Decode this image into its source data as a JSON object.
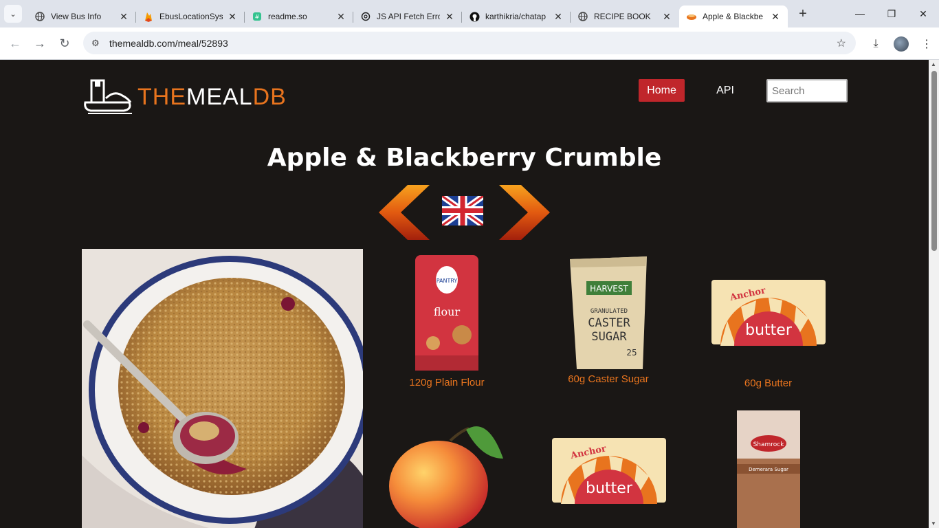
{
  "browser": {
    "tabs": [
      {
        "title": "View Bus Info",
        "icon": "globe-icon",
        "active": false
      },
      {
        "title": "EbusLocationSys",
        "icon": "firebase-icon",
        "active": false
      },
      {
        "title": "readme.so",
        "icon": "readme-icon",
        "active": false
      },
      {
        "title": "JS API Fetch Erro",
        "icon": "openai-icon",
        "active": false
      },
      {
        "title": "karthikria/chatap",
        "icon": "github-icon",
        "active": false
      },
      {
        "title": "RECIPE BOOK",
        "icon": "globe-icon",
        "active": false
      },
      {
        "title": "Apple & Blackbe",
        "icon": "meal-icon",
        "active": true
      }
    ],
    "url": "themealdb.com/meal/52893"
  },
  "site": {
    "logo_part1": "THE",
    "logo_part2": "MEAL",
    "logo_part3": "DB",
    "nav_home": "Home",
    "nav_api": "API",
    "search_placeholder": "Search"
  },
  "meal": {
    "title": "Apple & Blackberry Crumble",
    "flag": "uk-flag-icon"
  },
  "ingredients": [
    {
      "label": "120g Plain Flour"
    },
    {
      "label": "60g Caster Sugar"
    },
    {
      "label": "60g Butter"
    },
    {
      "label": ""
    },
    {
      "label": ""
    },
    {
      "label": ""
    }
  ],
  "colors": {
    "page_bg": "#1a1715",
    "accent_orange": "#e8741e",
    "home_red": "#c0262b"
  }
}
